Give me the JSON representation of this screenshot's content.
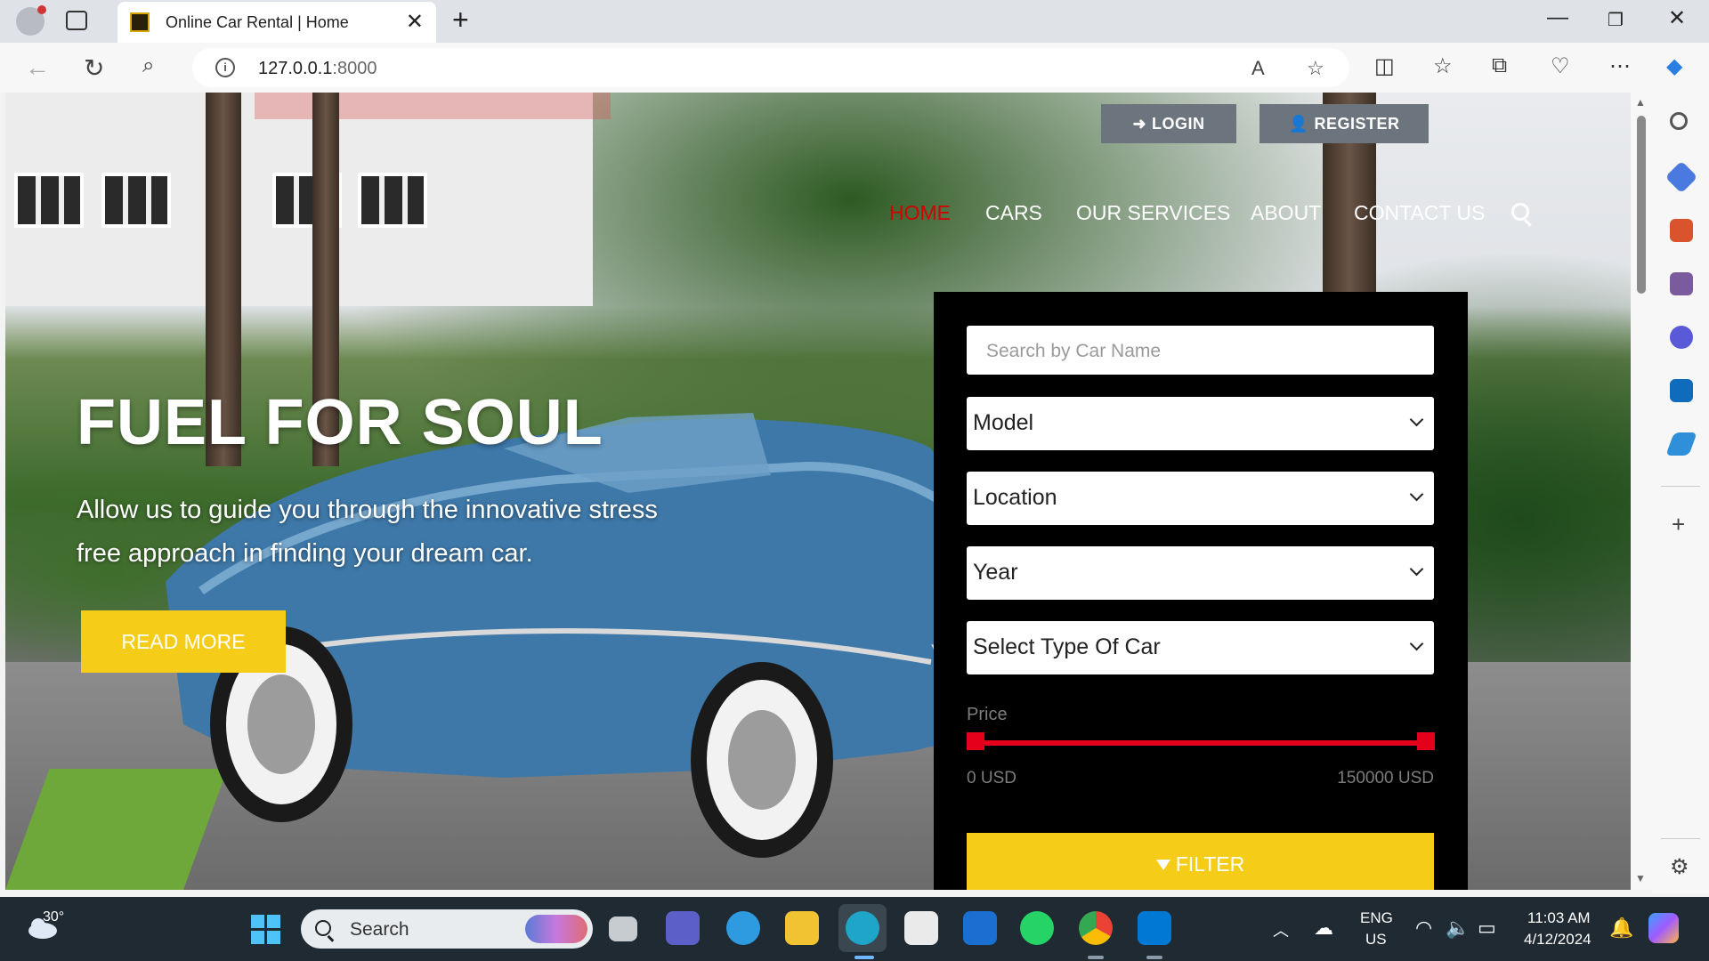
{
  "browser": {
    "tab_title": "Online Car Rental | Home",
    "url_host": "127.0.0.1",
    "url_port": ":8000"
  },
  "page": {
    "header": {
      "login_label": "LOGIN",
      "register_label": "REGISTER"
    },
    "nav": {
      "items": [
        {
          "label": "HOME",
          "active": true
        },
        {
          "label": "CARS",
          "active": false
        },
        {
          "label": "OUR SERVICES",
          "active": false
        },
        {
          "label": "ABOUT",
          "active": false
        },
        {
          "label": "CONTACT US",
          "active": false
        }
      ]
    },
    "hero": {
      "title": "FUEL FOR SOUL",
      "subtitle": "Allow us to guide you through the innovative stress free approach in finding your dream car.",
      "cta_label": "READ MORE"
    },
    "filter": {
      "search_placeholder": "Search by Car Name",
      "selects": [
        "Model",
        "Location",
        "Year",
        "Select Type Of Car"
      ],
      "price_label": "Price",
      "price_min": "0 USD",
      "price_max": "150000 USD",
      "button_label": "FILTER"
    },
    "colors": {
      "accent_yellow": "#f5cc17",
      "nav_active": "#d30000",
      "slider_red": "#e4001b",
      "auth_button_gray": "#6c757d"
    }
  },
  "taskbar": {
    "temperature": "30°",
    "search_label": "Search",
    "language": "ENG",
    "region": "US",
    "time": "11:03 AM",
    "date": "4/12/2024"
  }
}
